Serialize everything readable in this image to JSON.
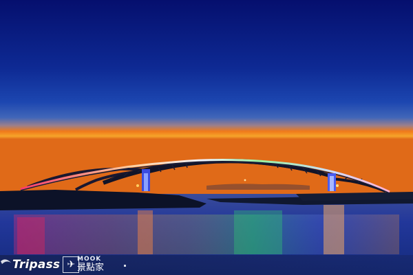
{
  "image": {
    "colors": {
      "sky_top": "#07137a",
      "sky_mid": "#1e3fa8",
      "horizon_orange": "#f07a1a",
      "horizon_yellow": "#f5a42a",
      "water": "#1a2f8a",
      "bridge_lights": "#e8f0ff"
    }
  },
  "watermark": {
    "brand": "Tripass",
    "partner_top": "MOOK",
    "partner_bottom": "景點家"
  }
}
